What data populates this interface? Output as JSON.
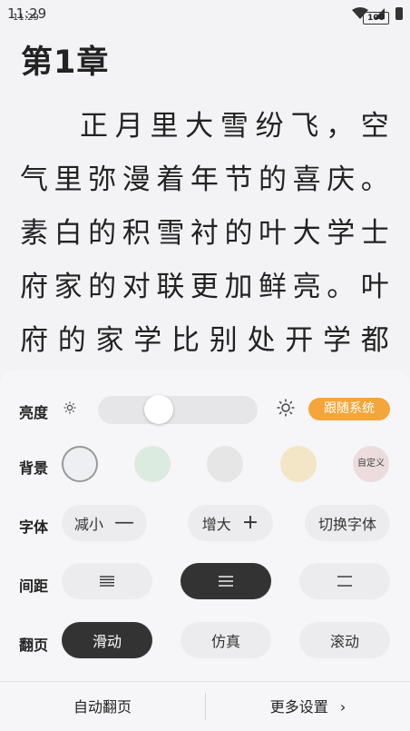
{
  "status_bar": {
    "time": "11:29",
    "time_shadow": "11:29",
    "battery": "100"
  },
  "reader": {
    "chapter_title": "第1章",
    "content": "正月里大雪纷飞，空气里弥漫着年节的喜庆。素白的积雪衬的叶大学士府家的对联更加鲜亮。叶府的家学比别处开学都早，孩子们都在学里，家里安安静静的。"
  },
  "settings": {
    "brightness": {
      "label": "亮度",
      "level_percent": 38,
      "follow_system_label": "跟随系统",
      "follow_system_color": "#f4a63a"
    },
    "background": {
      "label": "背景",
      "swatches": [
        {
          "color": "#eeeff3",
          "selected": true
        },
        {
          "color": "#dcebdf",
          "selected": false
        },
        {
          "color": "#e6e6e6",
          "selected": false
        },
        {
          "color": "#f3e6c6",
          "selected": false
        }
      ],
      "custom_label": "自定义",
      "custom_color": "#ecdcdd"
    },
    "font": {
      "label": "字体",
      "decrease_label": "减小",
      "increase_label": "增大",
      "switch_label": "切换字体"
    },
    "spacing": {
      "label": "间距",
      "options": [
        "compact",
        "normal",
        "loose"
      ],
      "selected": "normal"
    },
    "paging": {
      "label": "翻页",
      "options": [
        "滑动",
        "仿真",
        "滚动"
      ],
      "selected": "滑动"
    }
  },
  "bottom": {
    "auto_page_label": "自动翻页",
    "more_settings_label": "更多设置"
  }
}
